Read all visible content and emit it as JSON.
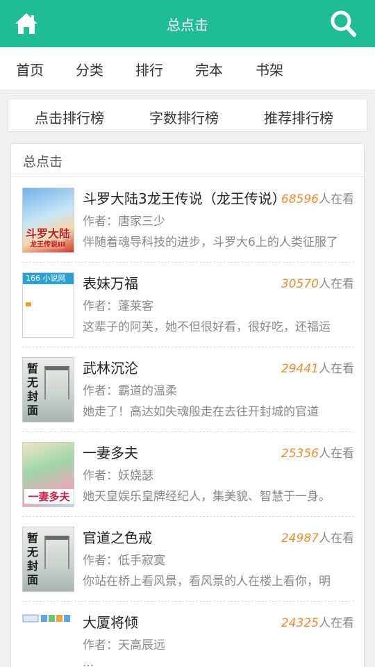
{
  "header": {
    "title": "总点击"
  },
  "nav": [
    {
      "label": "首页"
    },
    {
      "label": "分类"
    },
    {
      "label": "排行"
    },
    {
      "label": "完本"
    },
    {
      "label": "书架"
    }
  ],
  "tabs": [
    {
      "label": "点击排行榜"
    },
    {
      "label": "字数排行榜"
    },
    {
      "label": "推荐排行榜"
    }
  ],
  "panel": {
    "title": "总点击"
  },
  "books": [
    {
      "title": "斗罗大陆3龙王传说（龙王传说）",
      "count": "68596",
      "count_suffix": "人在看",
      "author": "作者：唐家三少",
      "intro": "伴随着魂导科技的进步，斗罗大6上的人类征服了",
      "cover_text": "斗罗大陆",
      "cover_sub": "龙王传说III"
    },
    {
      "title": "表妹万福",
      "count": "30570",
      "count_suffix": "人在看",
      "author": "作者：蓬莱客",
      "intro": "这辈子的阿芙，她不但很好看，很好吃，还福运",
      "cover_text": "166 小说网"
    },
    {
      "title": "武林沉沦",
      "count": "29441",
      "count_suffix": "人在看",
      "author": "作者：霸道的温柔",
      "intro": "她走了！高达如失魂般走在去往开封城的官道",
      "cover_text": "暂无封面"
    },
    {
      "title": "一妻多夫",
      "count": "25356",
      "count_suffix": "人在看",
      "author": "作者：妖娆瑟",
      "intro": "她天皇娱乐皇牌经纪人，集美貌、智慧于一身。",
      "cover_text": "一妻多夫"
    },
    {
      "title": "官道之色戒",
      "count": "24987",
      "count_suffix": "人在看",
      "author": "作者：低手寂寞",
      "intro": "你站在桥上看风景，看风景的人在楼上看你，明",
      "cover_text": "暂无封面"
    },
    {
      "title": "大厦将倾",
      "count": "24325",
      "count_suffix": "人在看",
      "author": "作者：天高辰远",
      "intro": "...",
      "cover_text": ""
    }
  ],
  "colors": {
    "brand": "#1fbc96",
    "count": "#f08a2c"
  },
  "icons": {
    "home": "home-icon",
    "search": "search-icon"
  }
}
